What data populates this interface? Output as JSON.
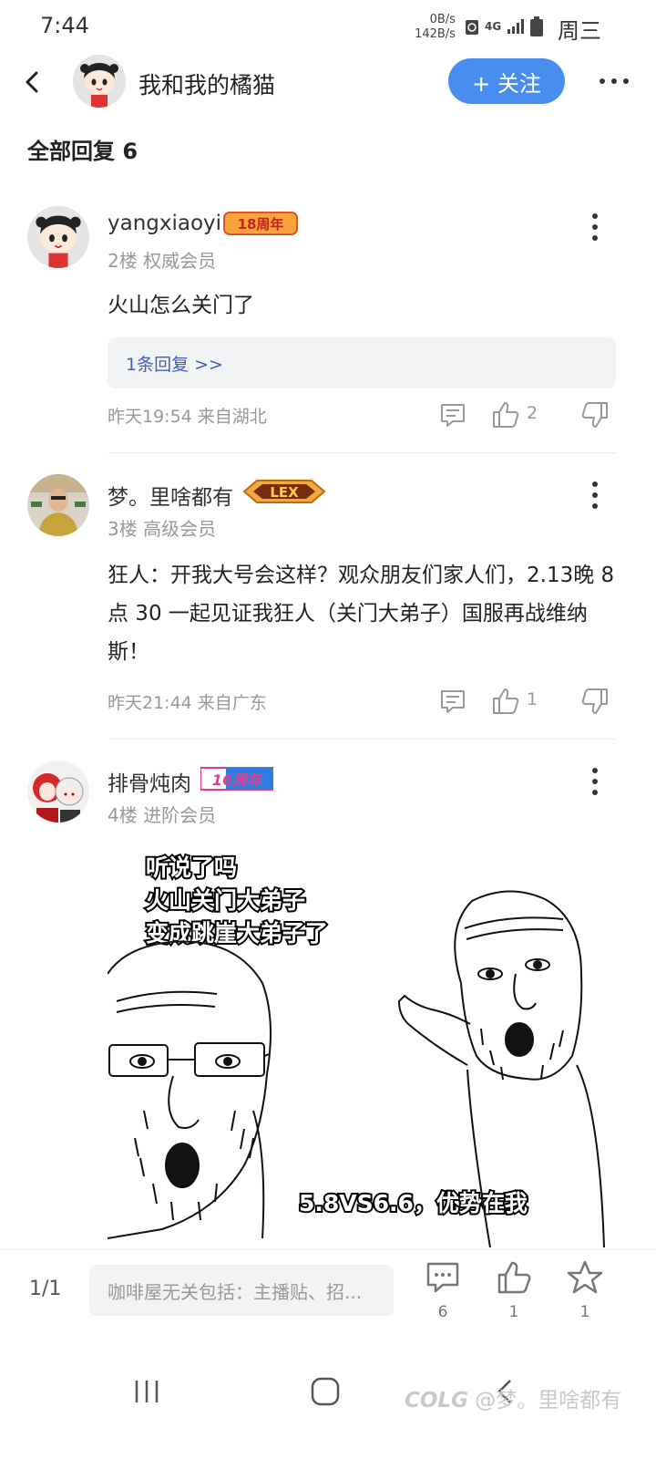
{
  "status_bar": {
    "time": "7:44",
    "speed_down": "0B/s",
    "speed_up": "142B/s",
    "network": "4G",
    "day": "周三"
  },
  "header": {
    "title": "我和我的橘猫",
    "follow_label": "+ 关注"
  },
  "replies_heading": "全部回复  6",
  "comments": [
    {
      "username": "yangxiaoyi",
      "badge": "18周年",
      "floor_rank": "2楼  权威会员",
      "text": "火山怎么关门了",
      "reply_summary": "1条回复 >>",
      "time_location": "昨天19:54 来自湖北",
      "like_count": "2"
    },
    {
      "username": "梦。里啥都有",
      "badge": "LEX",
      "floor_rank": "3楼  高级会员",
      "text": "狂人：开我大号会这样？观众朋友们家人们，2.13晚 8 点 30 一起见证我狂人（关门大弟子）国服再战维纳斯！",
      "time_location": "昨天21:44 来自广东",
      "like_count": "1"
    },
    {
      "username": "排骨炖肉",
      "badge": "16周年",
      "floor_rank": "4楼  进阶会员",
      "meme_caption_lines": [
        "听说了吗",
        "火山关门大弟子",
        "变成跳崖大弟子了"
      ],
      "meme_bottom_caption": "5.8VS6.6，优势在我"
    }
  ],
  "bottom_bar": {
    "pager": "1/1",
    "reply_placeholder": "咖啡屋无关包括：主播贴、招...",
    "comment_count": "6",
    "like_count": "1",
    "favorite_count": "1"
  },
  "watermark": {
    "logo": "COLG",
    "handle": "@梦。里啥都有"
  },
  "colors": {
    "accent": "#4a8df0",
    "link": "#3b62b8",
    "muted": "#999999"
  }
}
